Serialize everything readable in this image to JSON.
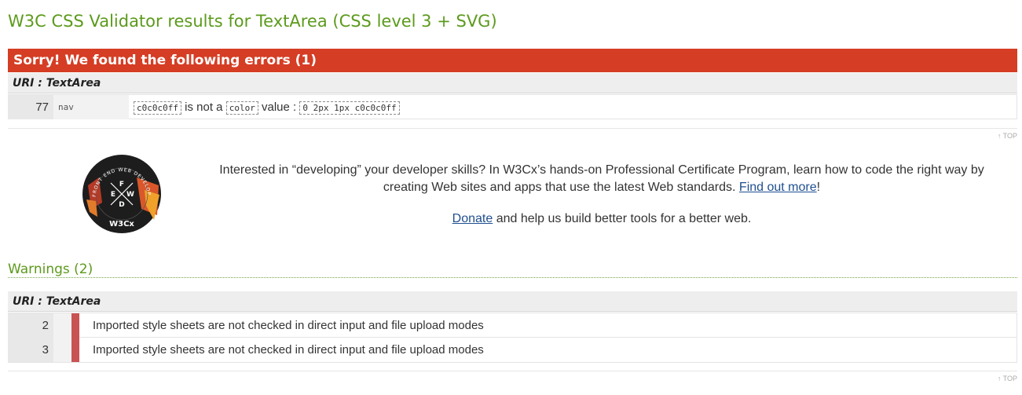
{
  "page_title": "W3C CSS Validator results for TextArea (CSS level 3 + SVG)",
  "errors": {
    "banner": "Sorry! We found the following errors (1)",
    "uri_label": "URI : TextArea",
    "rows": [
      {
        "line": "77",
        "context": "nav",
        "value_code": "c0c0c0ff",
        "text_is_not_a": "is not a",
        "type_code": "color",
        "text_value": "value :",
        "full_code": "0 2px 1px c0c0c0ff"
      }
    ]
  },
  "top_link": "↑ TOP",
  "promo": {
    "logo_text": "W3Cx",
    "logo_badge_letters": [
      "F",
      "E",
      "W",
      "D"
    ],
    "logo_ring_text": "FRONT END WEB DEVELOPER",
    "text_before": "Interested in “developing” your developer skills? In W3Cx’s hands-on Professional Certificate Program, learn how to code the right way by creating Web sites and apps that use the latest Web standards.",
    "find_out_link": "Find out more",
    "text_after_link": "!",
    "donate_link": "Donate",
    "donate_text": "and help us build better tools for a better web."
  },
  "warnings": {
    "title": "Warnings (2)",
    "uri_label": "URI : TextArea",
    "rows": [
      {
        "line": "2",
        "message": "Imported style sheets are not checked in direct input and file upload modes"
      },
      {
        "line": "3",
        "message": "Imported style sheets are not checked in direct input and file upload modes"
      }
    ]
  },
  "colors": {
    "title_green": "#5c9a1c",
    "error_red": "#d53d24",
    "warning_bar": "#c95353",
    "link_blue": "#1f4f8f"
  }
}
